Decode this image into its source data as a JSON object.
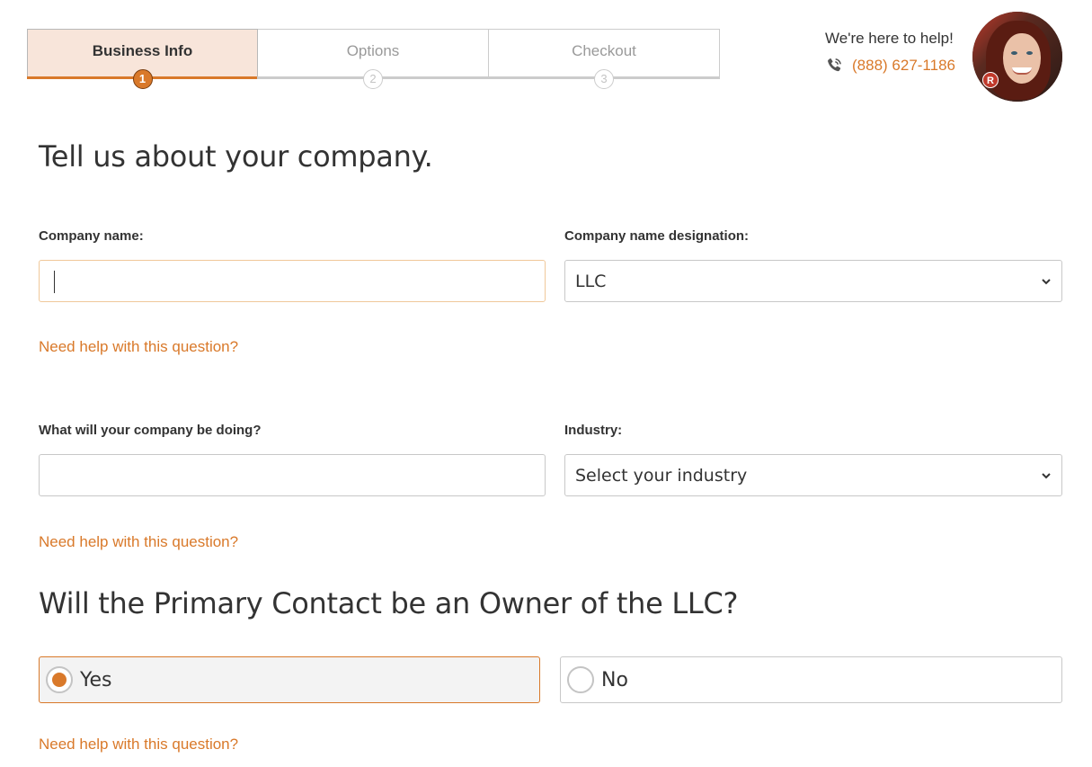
{
  "stepper": {
    "steps": [
      {
        "label": "Business Info",
        "number": "1",
        "state": "active"
      },
      {
        "label": "Options",
        "number": "2",
        "state": "inactive"
      },
      {
        "label": "Checkout",
        "number": "3",
        "state": "inactive"
      }
    ]
  },
  "help": {
    "text": "We're here to help!",
    "phone": "(888) 627-1186",
    "phone_icon": "phone-icon",
    "avatar_badge": "R"
  },
  "form": {
    "heading": "Tell us about your company.",
    "company_name": {
      "label": "Company name:",
      "value": "",
      "placeholder": ""
    },
    "designation": {
      "label": "Company name designation:",
      "selected": "LLC"
    },
    "help_link_1": "Need help with this question?",
    "purpose": {
      "label": "What will your company be doing?",
      "value": "",
      "placeholder": ""
    },
    "industry": {
      "label": "Industry:",
      "selected": "Select your industry"
    },
    "help_link_2": "Need help with this question?",
    "owner_question": "Will the Primary Contact be an Owner of the LLC?",
    "owner_options": [
      {
        "label": "Yes",
        "checked": true
      },
      {
        "label": "No",
        "checked": false
      }
    ],
    "help_link_3": "Need help with this question?"
  },
  "colors": {
    "accent": "#d9792a",
    "active_step_bg": "#f8e5da",
    "text": "#333333",
    "muted": "#9a9a9a"
  }
}
